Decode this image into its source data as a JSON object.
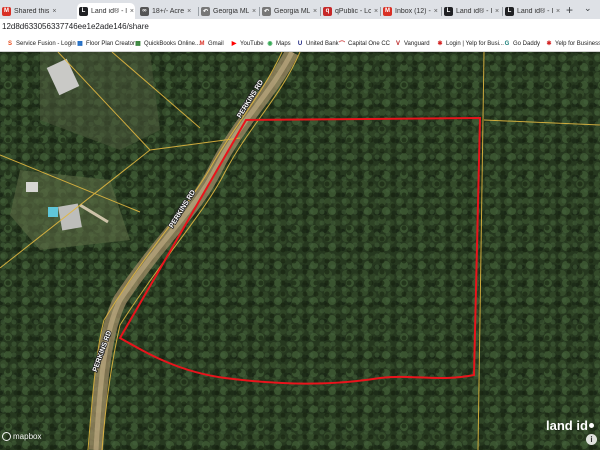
{
  "browser": {
    "tabs": [
      {
        "label": "Shared this",
        "icon": "gmail-icon",
        "color": "#d93025",
        "glyph": "M"
      },
      {
        "label": "Land id® - l",
        "icon": "landid-icon",
        "color": "#202124",
        "glyph": "L",
        "active": true
      },
      {
        "label": "18+/- Acre",
        "icon": "loop-icon",
        "color": "#555555",
        "glyph": "∞"
      },
      {
        "label": "Georgia MLS",
        "icon": "gamls-icon",
        "color": "#777777",
        "glyph": "↶"
      },
      {
        "label": "Georgia MLS",
        "icon": "gamls-icon",
        "color": "#777777",
        "glyph": "↶"
      },
      {
        "label": "qPublic - Lo",
        "icon": "qpublic-icon",
        "color": "#c62828",
        "glyph": "q"
      },
      {
        "label": "Inbox (12) -",
        "icon": "gmail-icon",
        "color": "#d93025",
        "glyph": "M"
      },
      {
        "label": "Land id® - I",
        "icon": "landid-icon",
        "color": "#202124",
        "glyph": "L"
      },
      {
        "label": "Land id® - I",
        "icon": "landid-icon",
        "color": "#202124",
        "glyph": "L"
      }
    ],
    "url": "12d8d633056337746ee1e2ade146/share",
    "bookmarks": [
      {
        "label": "Service Fusion - Login",
        "icon": "sf-icon",
        "color": "#e64a19",
        "glyph": "S"
      },
      {
        "label": "Floor Plan Creator",
        "icon": "floorplan-icon",
        "color": "#1565c0",
        "glyph": "▦"
      },
      {
        "label": "QuickBooks Online...",
        "icon": "quickbooks-icon",
        "color": "#2e7d32",
        "glyph": "▦"
      },
      {
        "label": "Gmail",
        "icon": "gmail-icon",
        "color": "#d93025",
        "glyph": "M"
      },
      {
        "label": "YouTube",
        "icon": "youtube-icon",
        "color": "#ff0000",
        "glyph": "▶"
      },
      {
        "label": "Maps",
        "icon": "maps-icon",
        "color": "#34a853",
        "glyph": "◉"
      },
      {
        "label": "United Bank",
        "icon": "bank-icon",
        "color": "#1a237e",
        "glyph": "U"
      },
      {
        "label": "Capital One CC",
        "icon": "capitalone-icon",
        "color": "#c62828",
        "glyph": "⌒"
      },
      {
        "label": "Vanguard",
        "icon": "vanguard-icon",
        "color": "#b71c1c",
        "glyph": "V"
      },
      {
        "label": "Login | Yelp for Busi...",
        "icon": "yelp-icon",
        "color": "#d32323",
        "glyph": "✱"
      },
      {
        "label": "Go Daddy",
        "icon": "godaddy-icon",
        "color": "#1b7f79",
        "glyph": "G"
      },
      {
        "label": "Yelp for Business O...",
        "icon": "yelp-icon",
        "color": "#d32323",
        "glyph": "✱"
      }
    ]
  },
  "map": {
    "road_labels": [
      "PERKINS RD",
      "PERKINS RD",
      "PERKINS RD"
    ],
    "parcel_outline_color": "#e8141c",
    "parcel_line_color": "#e0b640",
    "brand": "land id",
    "attribution": "mapbox",
    "info_glyph": "i"
  }
}
